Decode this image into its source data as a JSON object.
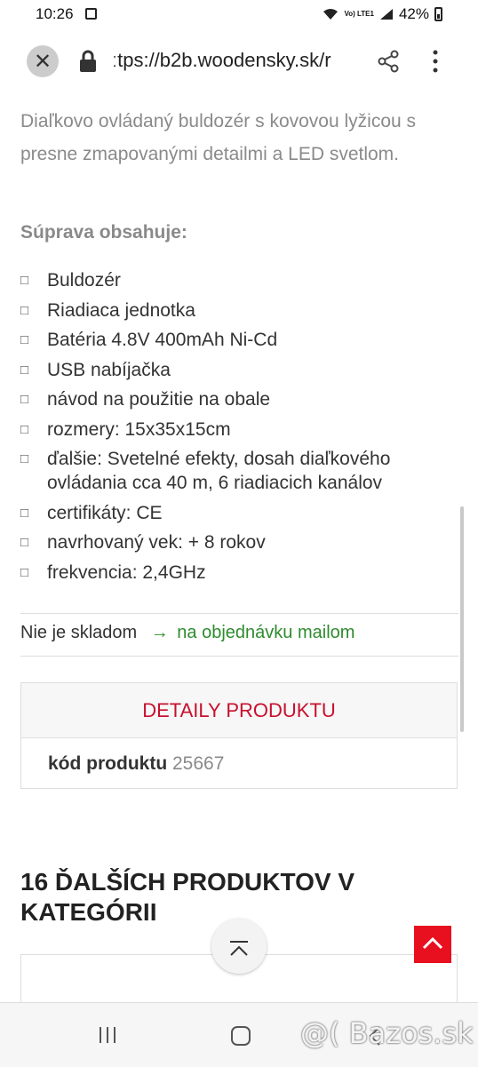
{
  "status_bar": {
    "time": "10:26",
    "battery": "42%",
    "network": "Vo) LTE1"
  },
  "browser": {
    "url": "ːtps://b2b.woodensky.sk/r"
  },
  "product": {
    "description": "Diaľkovo ovládaný buldozér s kovovou lyžicou s presne zmapovanými detailmi a LED svetlom.",
    "set_title": "Súprava obsahuje:",
    "bullet_glyph": "□",
    "items": [
      "Buldozér",
      "Riadiaca jednotka",
      "Batéria 4.8V 400mAh Ni-Cd",
      "USB nabíjačka",
      "návod na použitie na obale",
      "rozmery:  15x35x15cm",
      "ďalšie:  Svetelné efekty, dosah diaľkového ovládania cca 40 m, 6 riadiacich kanálov",
      "certifikáty:  CE",
      "navrhovaný vek:  + 8 rokov",
      "frekvencia:  2,4GHz"
    ],
    "stock_status": "Nie je skladom",
    "stock_arrow": "→",
    "stock_action": "na objednávku mailom"
  },
  "details": {
    "heading": "DETAILY PRODUKTU",
    "code_label": "kód produktu",
    "code_value": "25667"
  },
  "category": {
    "title": "16 ĎALŠÍCH PRODUKTOV V KATEGÓRII"
  },
  "watermark": "@( Bazos.sk",
  "colors": {
    "accent_red": "#e8101e",
    "heading_red": "#c8102e",
    "link_green": "#2e8b2e"
  }
}
